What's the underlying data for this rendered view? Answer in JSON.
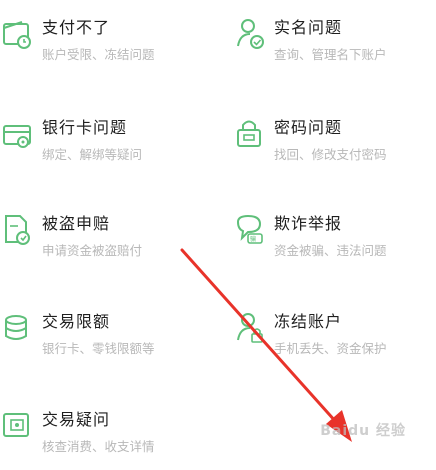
{
  "help_items": [
    {
      "title": "支付不了",
      "desc": "账户受限、冻结问题",
      "icon": "wallet-clock-icon"
    },
    {
      "title": "实名问题",
      "desc": "查询、管理名下账户",
      "icon": "user-check-icon"
    },
    {
      "title": "银行卡问题",
      "desc": "绑定、解绑等疑问",
      "icon": "bank-card-gear-icon"
    },
    {
      "title": "密码问题",
      "desc": "找回、修改支付密码",
      "icon": "lock-icon"
    },
    {
      "title": "被盗申赔",
      "desc": "申请资金被盗赔付",
      "icon": "document-shield-icon"
    },
    {
      "title": "欺诈举报",
      "desc": "资金被骗、违法问题",
      "icon": "alert-chat-icon"
    },
    {
      "title": "交易限额",
      "desc": "银行卡、零钱限额等",
      "icon": "coins-stack-icon"
    },
    {
      "title": "冻结账户",
      "desc": "手机丢失、资金保护",
      "icon": "user-lock-icon"
    },
    {
      "title": "交易疑问",
      "desc": "核查消费、收支详情",
      "icon": "wallet-document-icon"
    }
  ],
  "colors": {
    "icon_green": "#5fbf7a",
    "arrow_red": "#e8332a",
    "title": "#1f1f1f",
    "desc": "#b8b8b8"
  },
  "watermark": {
    "text": "Baidu 经验"
  }
}
